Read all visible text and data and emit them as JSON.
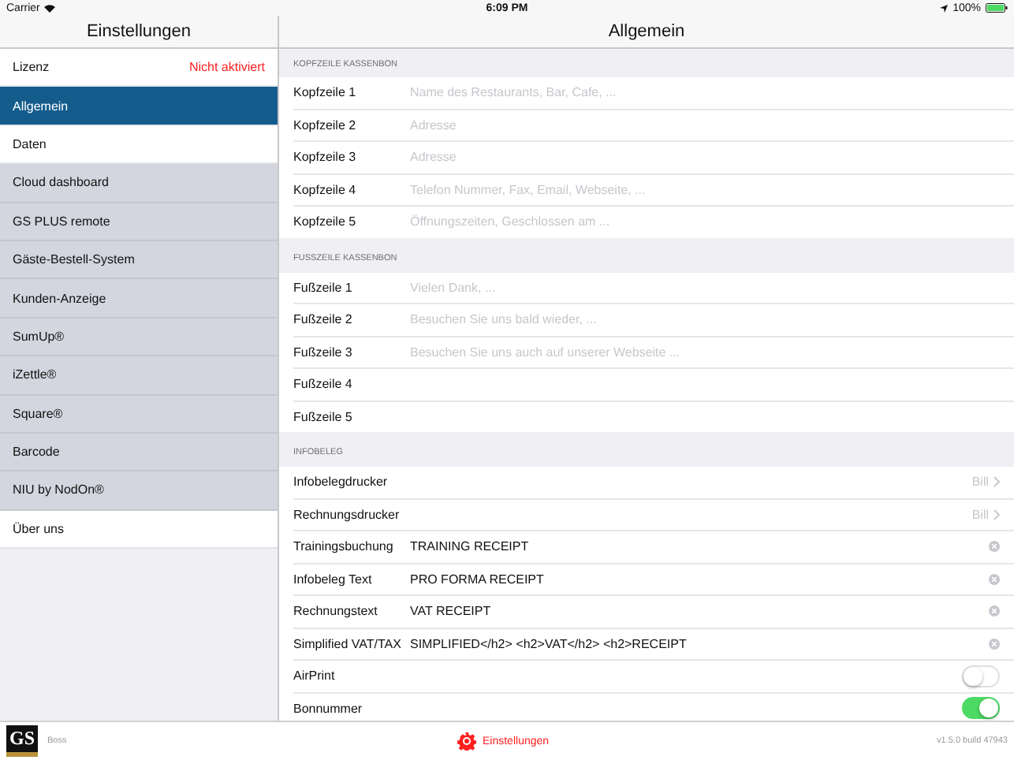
{
  "status_bar": {
    "carrier": "Carrier",
    "time": "6:09 PM",
    "battery": "100%"
  },
  "sidebar": {
    "title": "Einstellungen",
    "items": [
      {
        "label": "Lizenz",
        "value": "Nicht aktiviert",
        "selected": false,
        "disabled": false
      },
      {
        "label": "Allgemein",
        "selected": true,
        "disabled": false
      },
      {
        "label": "Daten",
        "selected": false,
        "disabled": false
      },
      {
        "label": "Cloud dashboard",
        "selected": false,
        "disabled": true
      },
      {
        "label": "GS PLUS remote",
        "selected": false,
        "disabled": true
      },
      {
        "label": "Gäste-Bestell-System",
        "selected": false,
        "disabled": true
      },
      {
        "label": "Kunden-Anzeige",
        "selected": false,
        "disabled": true
      },
      {
        "label": "SumUp®",
        "selected": false,
        "disabled": true
      },
      {
        "label": "iZettle®",
        "selected": false,
        "disabled": true
      },
      {
        "label": "Square®",
        "selected": false,
        "disabled": true
      },
      {
        "label": "Barcode",
        "selected": false,
        "disabled": true
      },
      {
        "label": "NIU by NodOn®",
        "selected": false,
        "disabled": true
      },
      {
        "label": "Über uns",
        "selected": false,
        "disabled": false
      }
    ]
  },
  "detail": {
    "title": "Allgemein",
    "sections": [
      {
        "header": "KOPFZEILE KASSENBON",
        "rows": [
          {
            "kind": "field",
            "label": "Kopfzeile 1",
            "placeholder": "Name des Restaurants, Bar, Cafe, ..."
          },
          {
            "kind": "field",
            "label": "Kopfzeile 2",
            "placeholder": "Adresse"
          },
          {
            "kind": "field",
            "label": "Kopfzeile 3",
            "placeholder": "Adresse"
          },
          {
            "kind": "field",
            "label": "Kopfzeile 4",
            "placeholder": "Telefon Nummer, Fax, Email, Webseite, ..."
          },
          {
            "kind": "field",
            "label": "Kopfzeile 5",
            "placeholder": "Öffnungszeiten, Geschlossen am ..."
          }
        ]
      },
      {
        "header": "FUSSZEILE KASSENBON",
        "rows": [
          {
            "kind": "field",
            "label": "Fußzeile 1",
            "placeholder": "Vielen Dank, ..."
          },
          {
            "kind": "field",
            "label": "Fußzeile 2",
            "placeholder": "Besuchen Sie uns bald wieder, ..."
          },
          {
            "kind": "field",
            "label": "Fußzeile 3",
            "placeholder": "Besuchen Sie uns auch auf unserer Webseite ..."
          },
          {
            "kind": "field",
            "label": "Fußzeile 4"
          },
          {
            "kind": "field",
            "label": "Fußzeile 5"
          }
        ]
      },
      {
        "header": "INFOBELEG",
        "rows": [
          {
            "kind": "picker",
            "label": "Infobelegdrucker",
            "value": "Bill"
          },
          {
            "kind": "picker",
            "label": "Rechnungsdrucker",
            "value": "Bill"
          },
          {
            "kind": "field",
            "label": "Trainingsbuchung",
            "value": "TRAINING RECEIPT"
          },
          {
            "kind": "field",
            "label": "Infobeleg Text",
            "value": "PRO FORMA RECEIPT"
          },
          {
            "kind": "field",
            "label": "Rechnungstext",
            "value": "VAT RECEIPT"
          },
          {
            "kind": "field",
            "label": "Simplified VAT/TAX",
            "value": "SIMPLIFIED</h2> <h2>VAT</h2> <h2>RECEIPT"
          },
          {
            "kind": "switch",
            "label": "AirPrint",
            "on": false
          },
          {
            "kind": "switch",
            "label": "Bonnummer",
            "on": true
          }
        ]
      }
    ]
  },
  "bottom_bar": {
    "logo": "GS",
    "user": "Boss",
    "tab": "Einstellungen",
    "version": "v1.5.0 build 47943"
  }
}
